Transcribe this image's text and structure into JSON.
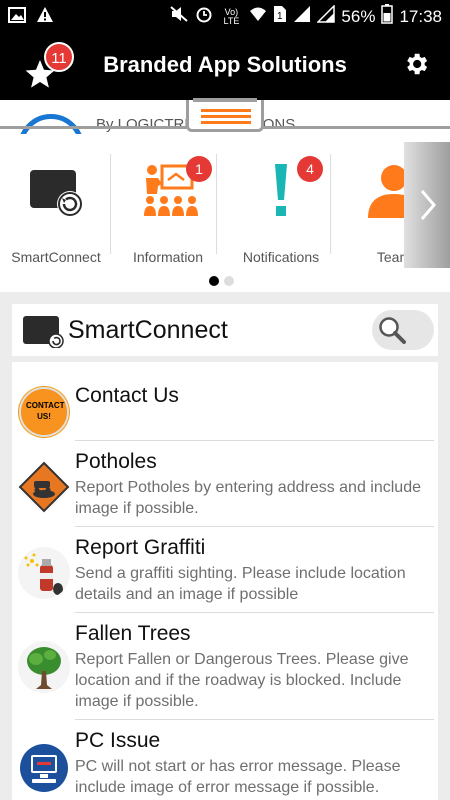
{
  "status_bar": {
    "battery": "56%",
    "time": "17:38",
    "network": "Vo) LTE"
  },
  "header": {
    "title": "Branded App Solutions",
    "favorites_badge": "11"
  },
  "banner": {
    "subtitle": "By LOGICTREE SOLUTIONS"
  },
  "carousel": {
    "items": [
      {
        "label": "SmartConnect",
        "icon": "smartconnect-icon",
        "badge": ""
      },
      {
        "label": "Information",
        "icon": "presentation-icon",
        "badge": "1"
      },
      {
        "label": "Notifications",
        "icon": "exclamation-icon",
        "badge": "4"
      },
      {
        "label": "Team",
        "icon": "person-icon",
        "badge": ""
      }
    ],
    "page": 1,
    "pages": 2
  },
  "section": {
    "title": "SmartConnect"
  },
  "list": [
    {
      "title": "Contact Us",
      "description": "",
      "icon_label": "CONTACT US!",
      "icon": "contact-us-icon"
    },
    {
      "title": "Potholes",
      "description": "Report Potholes by entering address and include image if possible.",
      "icon": "pothole-sign-icon"
    },
    {
      "title": "Report Graffiti",
      "description": "Send a graffiti sighting. Please include location details and an image if possible",
      "icon": "spray-can-icon"
    },
    {
      "title": "Fallen Trees",
      "description": "Report Fallen or Dangerous Trees. Please give location and if the roadway is blocked. Include image if possible.",
      "icon": "tree-icon"
    },
    {
      "title": "PC Issue",
      "description": "PC will not start or has error message. Please include image of error message if possible.",
      "icon": "computer-icon"
    }
  ],
  "colors": {
    "header_bg": "#000000",
    "badge": "#e53935",
    "accent_orange": "#ff7a1a",
    "teal": "#1ab5b5"
  }
}
